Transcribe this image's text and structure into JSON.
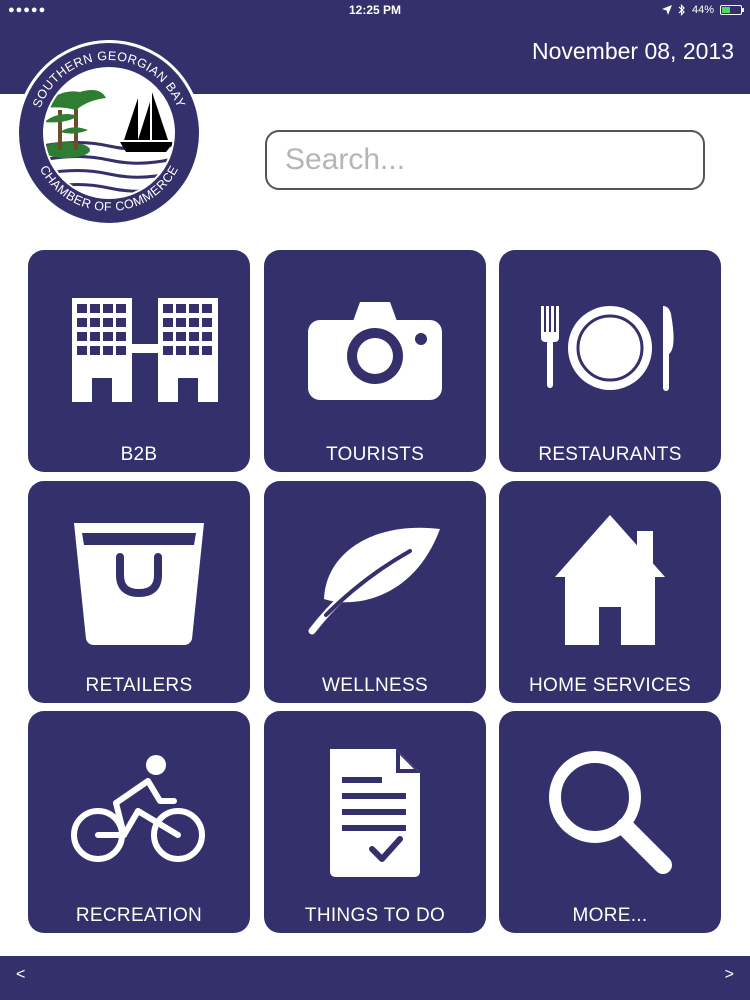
{
  "status_bar": {
    "signal": "●●●●●",
    "time": "12:25 PM",
    "battery": "44%",
    "battery_level": 0.44
  },
  "header": {
    "date": "November 08, 2013",
    "logo": {
      "top_text": "SOUTHERN GEORGIAN BAY",
      "bottom_text": "CHAMBER OF COMMERCE"
    }
  },
  "search": {
    "placeholder": "Search...",
    "value": ""
  },
  "tiles": [
    {
      "label": "B2B",
      "icon": "office-buildings-icon"
    },
    {
      "label": "TOURISTS",
      "icon": "camera-icon"
    },
    {
      "label": "RESTAURANTS",
      "icon": "fork-plate-knife-icon"
    },
    {
      "label": "RETAILERS",
      "icon": "shopping-bag-icon"
    },
    {
      "label": "WELLNESS",
      "icon": "leaf-icon"
    },
    {
      "label": "HOME SERVICES",
      "icon": "house-icon"
    },
    {
      "label": "RECREATION",
      "icon": "cyclist-icon"
    },
    {
      "label": "THINGS TO DO",
      "icon": "checklist-document-icon"
    },
    {
      "label": "MORE...",
      "icon": "magnifier-icon"
    }
  ],
  "nav": {
    "back": "<",
    "forward": ">"
  },
  "colors": {
    "brand_navy": "#34306b",
    "battery_green": "#4cd964"
  }
}
